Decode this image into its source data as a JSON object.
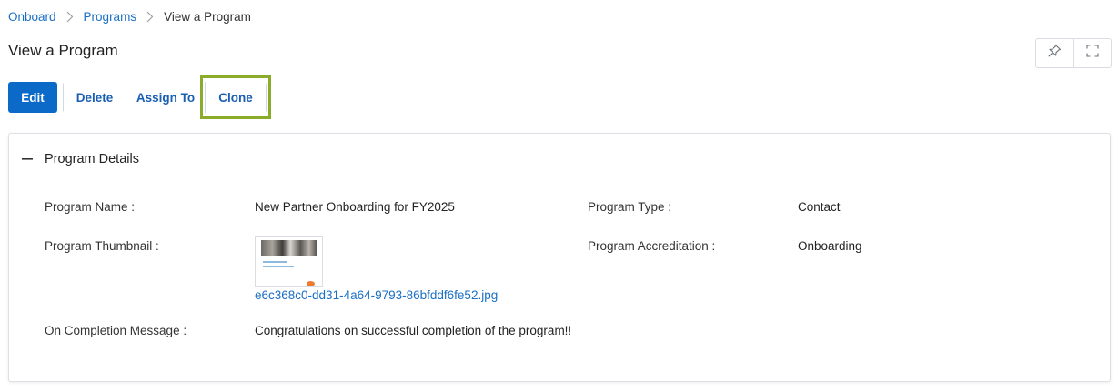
{
  "breadcrumb": {
    "items": [
      "Onboard",
      "Programs"
    ],
    "current": "View a Program"
  },
  "page": {
    "title": "View a Program"
  },
  "toolbar": {
    "edit_label": "Edit",
    "delete_label": "Delete",
    "assign_label": "Assign To",
    "clone_label": "Clone"
  },
  "icons": {
    "pin": "pin-icon",
    "expand": "fullscreen-icon",
    "collapse": "minus-icon",
    "separator": "chevron-right-icon"
  },
  "colors": {
    "primary": "#0b6ac8",
    "link": "#1a6fc4",
    "highlight": "#8aac2a"
  },
  "details": {
    "section_title": "Program Details",
    "program_name_label": "Program Name :",
    "program_name_value": "New Partner Onboarding for FY2025",
    "program_type_label": "Program Type :",
    "program_type_value": "Contact",
    "thumbnail_label": "Program Thumbnail :",
    "thumbnail_file": "e6c368c0-dd31-4a64-9793-86bfddf6fe52.jpg",
    "accreditation_label": "Program Accreditation :",
    "accreditation_value": "Onboarding",
    "completion_label": "On Completion Message :",
    "completion_value": "Congratulations on successful completion of the program!!"
  }
}
